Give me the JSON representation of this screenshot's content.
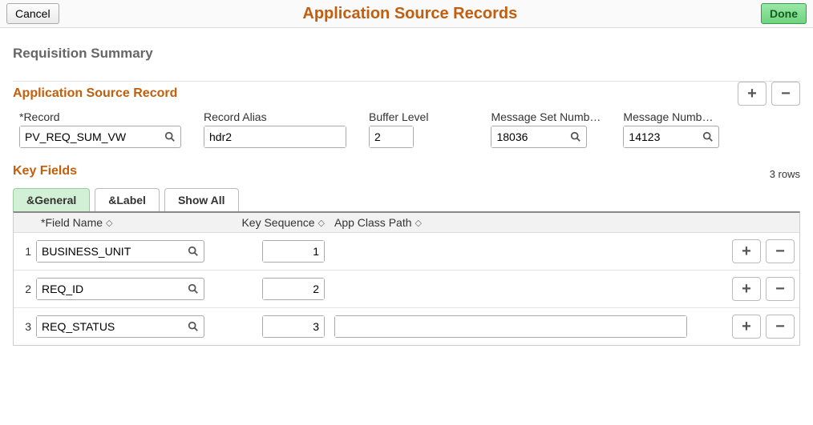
{
  "header": {
    "cancel": "Cancel",
    "title": "Application Source Records",
    "done": "Done"
  },
  "subtitle": "Requisition Summary",
  "app_source_record": {
    "title": "Application Source Record",
    "fields": {
      "record": {
        "label": "*Record",
        "value": "PV_REQ_SUM_VW"
      },
      "alias": {
        "label": "Record Alias",
        "value": "hdr2"
      },
      "buffer": {
        "label": "Buffer Level",
        "value": "2"
      },
      "msg_set": {
        "label": "Message Set Numb…",
        "value": "18036"
      },
      "msg_num": {
        "label": "Message Numb…",
        "value": "14123"
      }
    }
  },
  "key_fields": {
    "title": "Key Fields",
    "row_count": "3 rows",
    "tabs": {
      "general": "&General",
      "label": "&Label",
      "show_all": "Show All"
    },
    "columns": {
      "field_name": "*Field Name",
      "key_seq": "Key Sequence",
      "class_path": "App Class Path"
    },
    "rows": [
      {
        "num": "1",
        "field": "BUSINESS_UNIT",
        "seq": "1",
        "class_path": ""
      },
      {
        "num": "2",
        "field": "REQ_ID",
        "seq": "2",
        "class_path": ""
      },
      {
        "num": "3",
        "field": "REQ_STATUS",
        "seq": "3",
        "class_path": ""
      }
    ]
  }
}
